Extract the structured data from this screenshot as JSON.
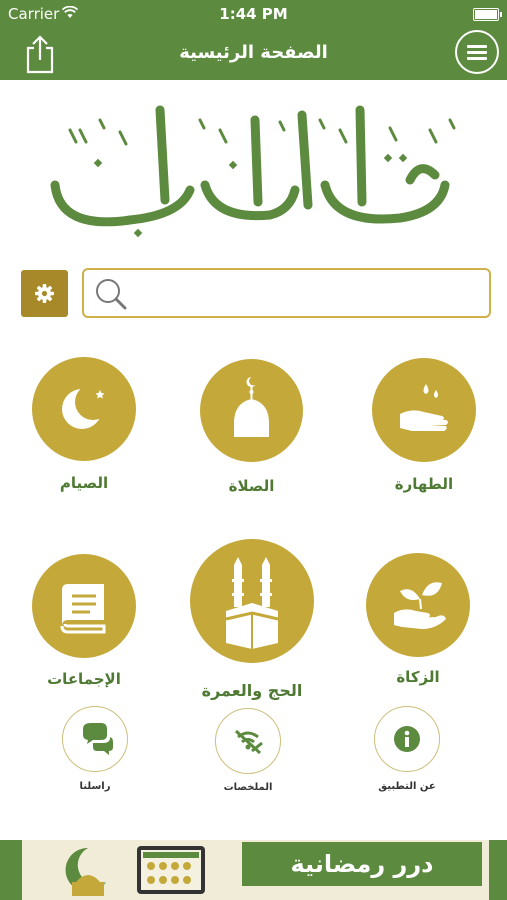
{
  "status_bar": {
    "carrier": "Carrier",
    "time": "1:44 PM"
  },
  "navbar": {
    "title": "الصفحة الرئيسية"
  },
  "search": {
    "placeholder": "",
    "value": ""
  },
  "tiles": [
    {
      "id": "siyam",
      "label": "الصيام",
      "icon": "crescent-moon-icon"
    },
    {
      "id": "salah",
      "label": "الصلاة",
      "icon": "mosque-dome-icon"
    },
    {
      "id": "tahara",
      "label": "الطهارة",
      "icon": "water-hand-icon"
    },
    {
      "id": "ijmaat",
      "label": "الإجماعات",
      "icon": "book-icon"
    },
    {
      "id": "hajj",
      "label": "الحج والعمرة",
      "icon": "kaaba-icon"
    },
    {
      "id": "zakat",
      "label": "الزكاة",
      "icon": "plant-hand-icon"
    }
  ],
  "small_tiles": [
    {
      "id": "contact",
      "label": "راسلنا",
      "icon": "chat-icon"
    },
    {
      "id": "summaries",
      "label": "الملخصات",
      "icon": "summaries-icon"
    },
    {
      "id": "about",
      "label": "عن التطبيق",
      "icon": "info-icon"
    }
  ],
  "banner": {
    "text": "درر رمضانية"
  },
  "colors": {
    "primary_green": "#5c8a3f",
    "gold": "#c4a93a",
    "label_green": "#4f7a33"
  }
}
